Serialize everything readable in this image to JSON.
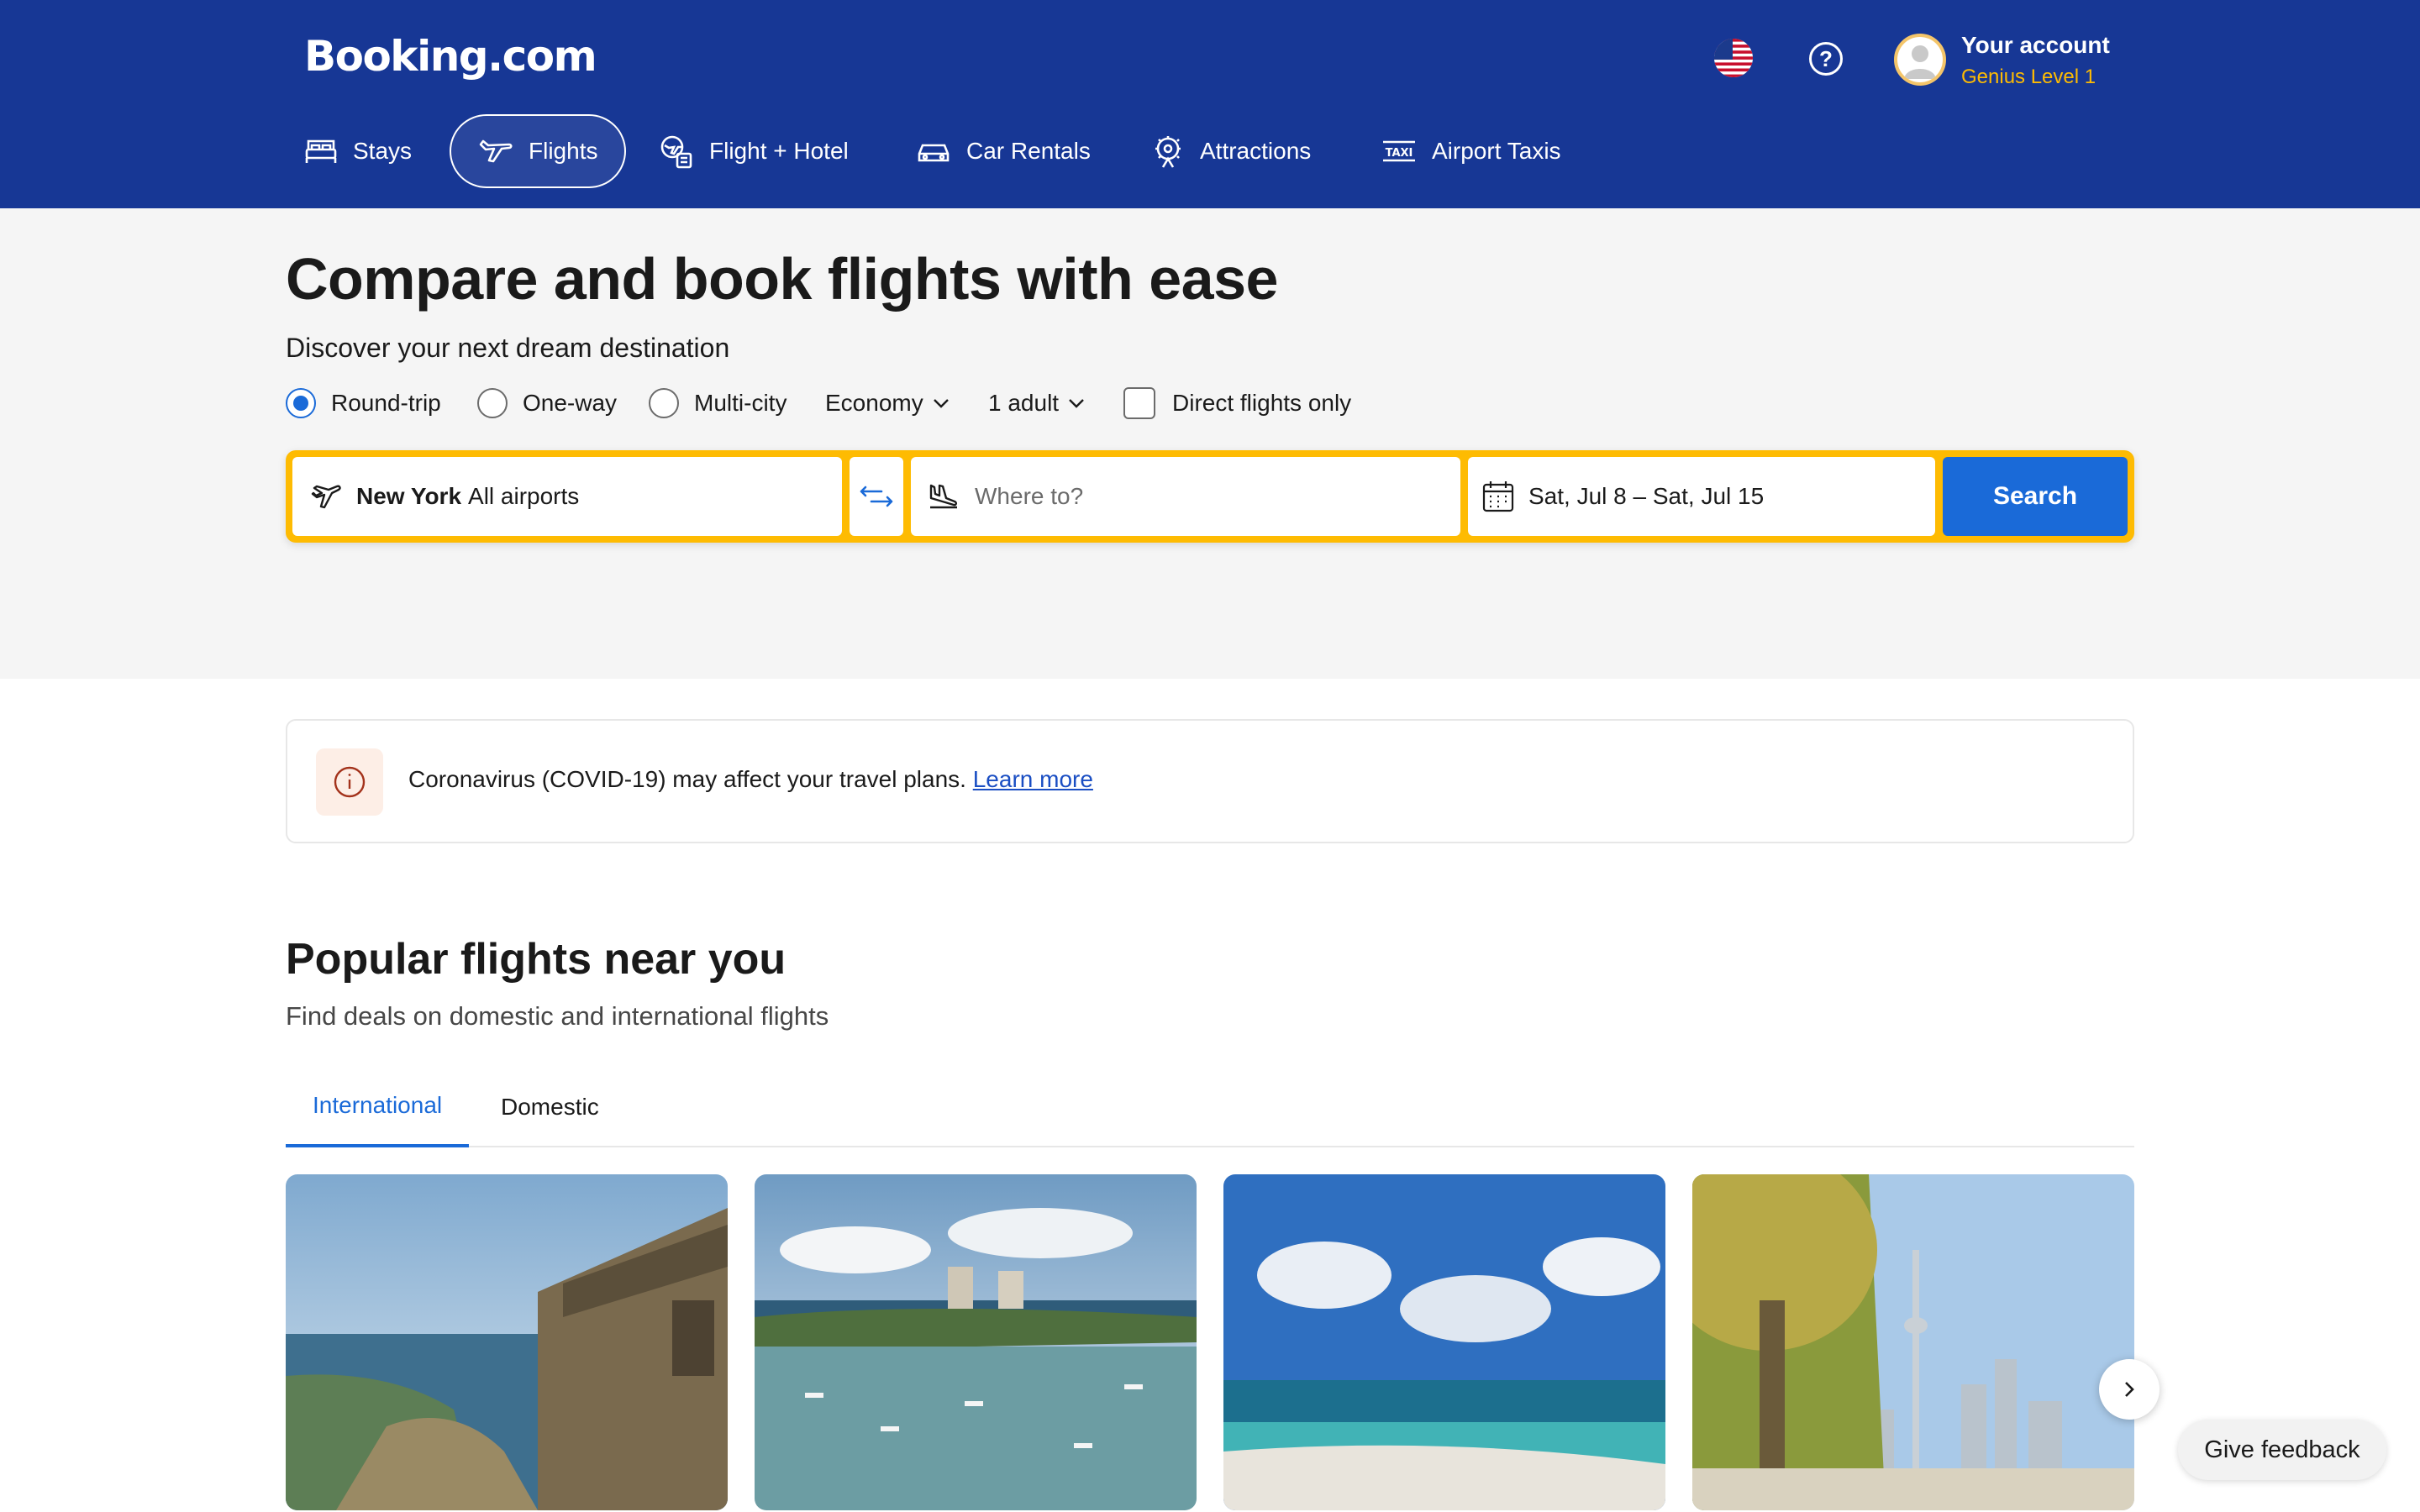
{
  "header": {
    "logo": "Booking.com",
    "account": {
      "name": "Your account",
      "level": "Genius Level 1"
    },
    "nav": [
      {
        "label": "Stays",
        "icon": "bed-icon"
      },
      {
        "label": "Flights",
        "icon": "plane-icon",
        "active": true
      },
      {
        "label": "Flight + Hotel",
        "icon": "flight-hotel-icon"
      },
      {
        "label": "Car Rentals",
        "icon": "car-icon"
      },
      {
        "label": "Attractions",
        "icon": "attractions-icon"
      },
      {
        "label": "Airport Taxis",
        "icon": "taxi-icon"
      }
    ]
  },
  "hero": {
    "title": "Compare and book flights with ease",
    "subtitle": "Discover your next dream destination",
    "trip_types": [
      "Round-trip",
      "One-way",
      "Multi-city"
    ],
    "selected_trip_type": "Round-trip",
    "cabin_class": "Economy",
    "travelers": "1 adult",
    "direct_only_label": "Direct flights only",
    "direct_only_checked": false
  },
  "search": {
    "from_city": "New York",
    "from_airports": "All airports",
    "to_placeholder": "Where to?",
    "dates": "Sat, Jul 8 – Sat, Jul 15",
    "button": "Search"
  },
  "notice": {
    "text": "Coronavirus (COVID-19) may affect your travel plans.",
    "link": "Learn more"
  },
  "popular": {
    "title": "Popular flights near you",
    "subtitle": "Find deals on domestic and international flights",
    "tabs": [
      "International",
      "Domestic"
    ],
    "active_tab": "International"
  },
  "feedback": "Give feedback",
  "colors": {
    "brand": "#173795",
    "accent": "#1a6ad8",
    "search_border": "#febb02",
    "genius": "#febb02"
  }
}
